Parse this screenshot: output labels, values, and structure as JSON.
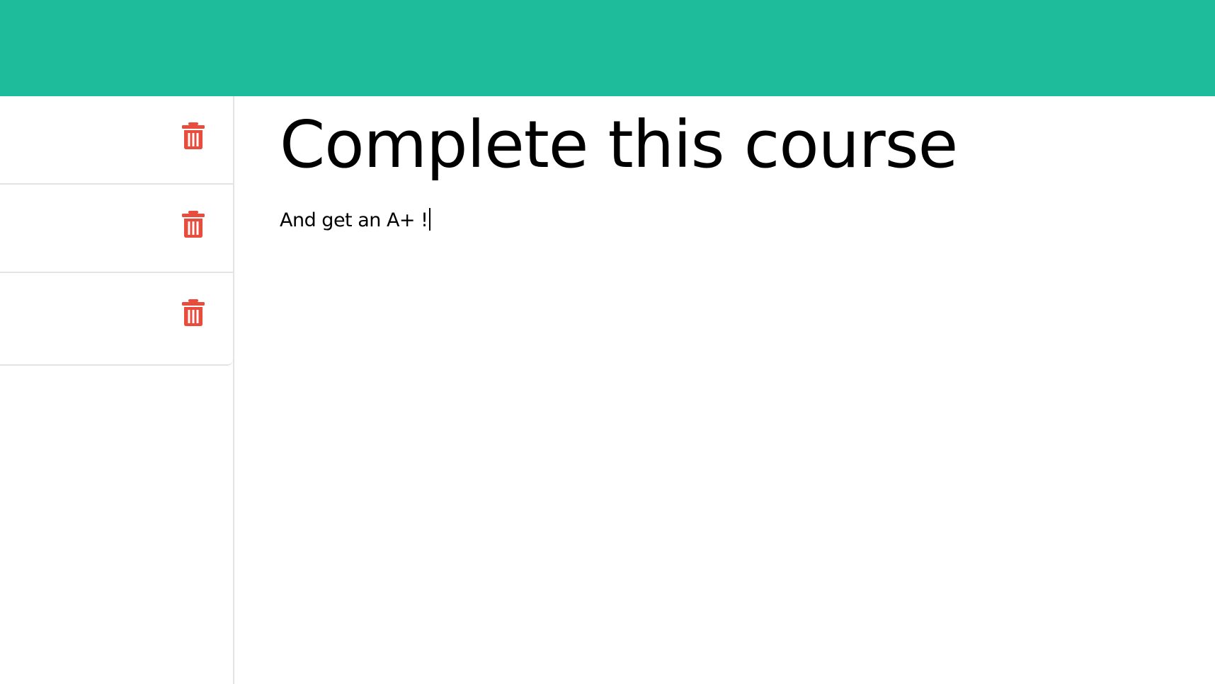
{
  "colors": {
    "header": "#1fbc9c",
    "delete_icon": "#e74c3c",
    "divider": "#e4e4e4"
  },
  "sidebar": {
    "items": [
      {
        "icon": "trash-icon"
      },
      {
        "icon": "trash-icon"
      },
      {
        "icon": "trash-icon"
      }
    ]
  },
  "editor": {
    "title": "Complete this course",
    "body": "And get an A+ !"
  }
}
